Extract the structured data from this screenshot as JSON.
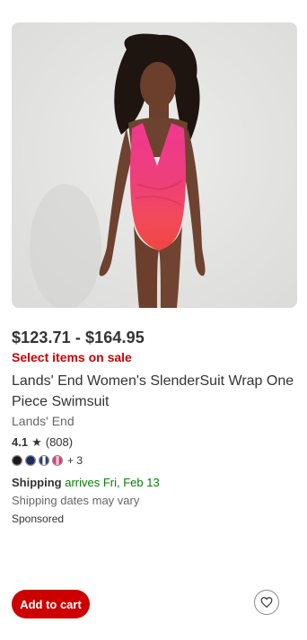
{
  "product": {
    "image_alt": "Model wearing pink to red ombre wrap one piece swimsuit",
    "price": "$123.71 - $164.95",
    "sale_label": "Select items on sale",
    "title": "Lands' End Women's SlenderSuit Wrap One Piece Swimsuit",
    "brand": "Lands' End",
    "rating_value": "4.1",
    "rating_icon": "star-icon",
    "review_count": "(808)",
    "swatches": [
      {
        "name": "black",
        "color": "#1a1a1a"
      },
      {
        "name": "navy",
        "color": "#1f2a5c"
      },
      {
        "name": "navy-white-stripe",
        "color": "#2b3b7a"
      },
      {
        "name": "pink-navy-pattern",
        "color": "#d83a78"
      }
    ],
    "more_colors": "+ 3",
    "shipping_label": "Shipping",
    "shipping_arrives": "arrives Fri, Feb 13",
    "shipping_note": "Shipping dates may vary",
    "sponsored": "Sponsored"
  },
  "actions": {
    "add_to_cart": "Add to cart",
    "favorite_icon": "heart-icon"
  },
  "colors": {
    "accent": "#cc0000",
    "shipping_green": "#008300"
  }
}
